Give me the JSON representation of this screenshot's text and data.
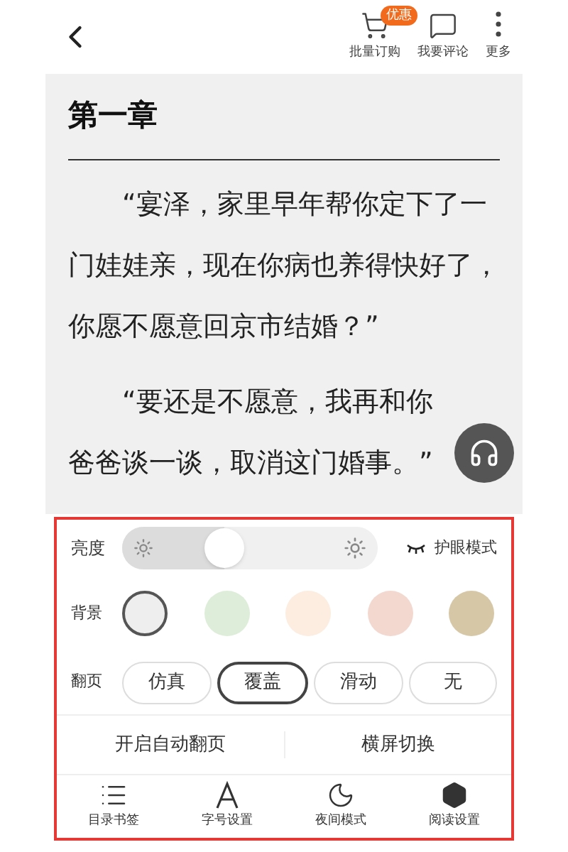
{
  "top_bar": {
    "actions": [
      {
        "kind": "cart",
        "label": "批量订购",
        "badge": "优惠"
      },
      {
        "kind": "comment",
        "label": "我要评论"
      },
      {
        "kind": "more",
        "label": "更多"
      }
    ]
  },
  "chapter": {
    "title": "第一章",
    "paragraphs": [
      "“宴泽，家里早年帮你定下了一门娃娃亲，现在你病也养得快好了，你愿不愿意回京市结婚？”",
      "“要还是不愿意，我再和你爸爸谈一谈，取消这门婚事。”"
    ]
  },
  "settings": {
    "brightness": {
      "label": "亮度",
      "level": 0.4
    },
    "eye_mode": {
      "label": "护眼模式"
    },
    "background": {
      "label": "背景",
      "options": [
        {
          "color": "#eeeeee",
          "selected": true
        },
        {
          "color": "#deedd9",
          "selected": false
        },
        {
          "color": "#fcede0",
          "selected": false
        },
        {
          "color": "#f3d8cf",
          "selected": false
        },
        {
          "color": "#d6c7a6",
          "selected": false
        }
      ]
    },
    "page_turn": {
      "label": "翻页",
      "options": [
        {
          "label": "仿真",
          "selected": false
        },
        {
          "label": "覆盖",
          "selected": true
        },
        {
          "label": "滑动",
          "selected": false
        },
        {
          "label": "无",
          "selected": false
        }
      ]
    },
    "toggles": [
      "开启自动翻页",
      "横屏切换"
    ]
  },
  "bottom_nav": [
    {
      "kind": "toc",
      "label": "目录书签"
    },
    {
      "kind": "font",
      "label": "字号设置"
    },
    {
      "kind": "night",
      "label": "夜间模式"
    },
    {
      "kind": "read",
      "label": "阅读设置"
    }
  ]
}
